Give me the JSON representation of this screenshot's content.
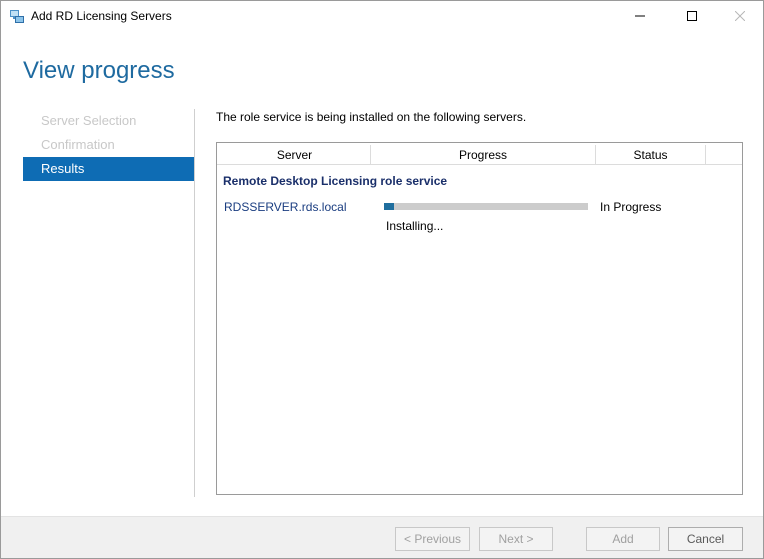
{
  "window": {
    "title": "Add RD Licensing Servers",
    "controls": [
      "minimize",
      "maximize",
      "close"
    ]
  },
  "header": {
    "title": "View progress"
  },
  "nav": {
    "items": [
      {
        "label": "Server Selection",
        "state": "disabled"
      },
      {
        "label": "Confirmation",
        "state": "disabled"
      },
      {
        "label": "Results",
        "state": "active"
      }
    ]
  },
  "main": {
    "intro": "The role service is being installed on the following servers.",
    "table": {
      "columns": [
        "Server",
        "Progress",
        "Status"
      ],
      "group_title": "Remote Desktop Licensing role service",
      "rows": [
        {
          "server": "RDSSERVER.rds.local",
          "progress_fraction": 0.05,
          "progress_text": "Installing...",
          "status": "In Progress"
        }
      ]
    }
  },
  "footer": {
    "previous": "< Previous",
    "next": "Next >",
    "add": "Add",
    "cancel": "Cancel"
  },
  "colors": {
    "accent": "#0e6cb4",
    "title": "#1e6aa0",
    "progress_fill": "#1f6e9e",
    "progress_track": "#cccccc"
  },
  "icons": {
    "app": "server-manager-icon",
    "minimize": "minimize-icon",
    "maximize": "maximize-icon",
    "close": "close-icon"
  }
}
